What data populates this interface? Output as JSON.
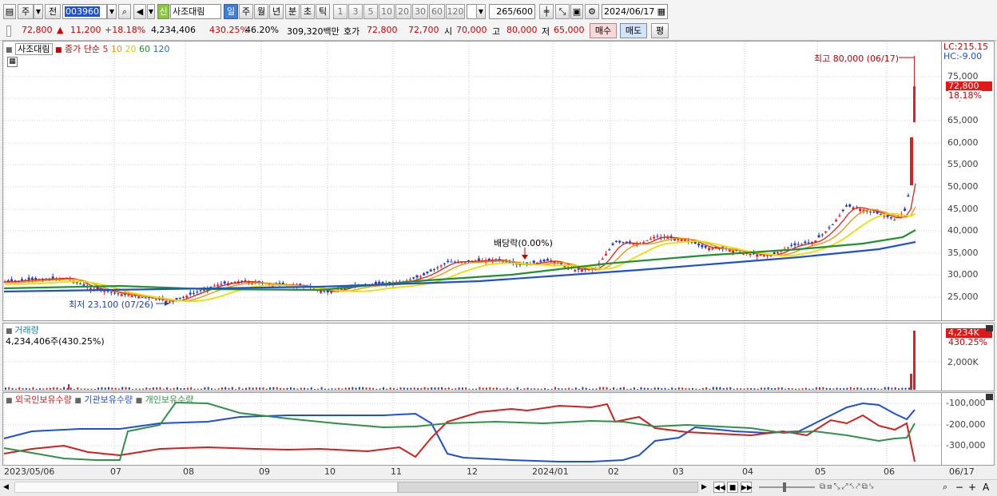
{
  "toolbar": {
    "market_type": "주",
    "prev_label": "전",
    "code": "003960",
    "badge": "신",
    "stock_name": "사조대림",
    "periods": [
      "일",
      "주",
      "월",
      "년",
      "분",
      "초",
      "틱"
    ],
    "active_period": "일",
    "intervals": [
      "1",
      "3",
      "5",
      "10",
      "20",
      "30",
      "60",
      "120"
    ],
    "count": "265",
    "count_max": "/600",
    "date": "2024/06/17"
  },
  "quote": {
    "price": "72,800",
    "change": "11,200",
    "change_pct": "+18.18%",
    "volume": "4,234,406",
    "volume_ratio": "430.25%",
    "turnover": "46.20%",
    "amount": "309,320백만",
    "bid_label": "호가",
    "ask": "72,800",
    "bid": "72,700",
    "open_label": "시",
    "open": "70,000",
    "high_label": "고",
    "high": "80,000",
    "low_label": "저",
    "low": "65,000",
    "buy_label": "매수",
    "sell_label": "매도",
    "eval_label": "평"
  },
  "price_chart": {
    "name_tag": "사조대림",
    "legend_main": "종가 단순",
    "ma_periods": [
      "5",
      "10",
      "20",
      "60",
      "120"
    ],
    "ma_colors": [
      "#e02020",
      "#f09000",
      "#e8e000",
      "#209030",
      "#2050d0"
    ],
    "lc": "LC:215.15",
    "hc": "HC:-9.00",
    "y_labels": [
      "75,000",
      "70,000",
      "65,000",
      "60,000",
      "55,000",
      "50,000",
      "45,000",
      "40,000",
      "35,000",
      "30,000",
      "25,000"
    ],
    "last_price": "72,800",
    "last_pct": "18.18%",
    "high_note": "최고 80,000 (06/17)",
    "low_note": "최저 23,100 (07/26)",
    "dividend_note": "배당락(0.00%)"
  },
  "volume_chart": {
    "title": "거래량",
    "value": "4,234,406주(430.25%)",
    "y_label": "2,000K",
    "last": "4,234K",
    "last_pct": "430.25%"
  },
  "holdings_chart": {
    "legend": [
      "외국인보유수량",
      "기관보유수량",
      "개인보유수량"
    ],
    "colors": [
      "#d02020",
      "#2050d0",
      "#30904a"
    ],
    "y_labels": [
      "-100,000",
      "-200,000",
      "-300,000"
    ]
  },
  "x_axis": [
    "2023/05/06",
    "07",
    "08",
    "09",
    "10",
    "11",
    "12",
    "2024/01",
    "02",
    "03",
    "04",
    "05",
    "06"
  ],
  "x_axis_last": "06/17"
}
